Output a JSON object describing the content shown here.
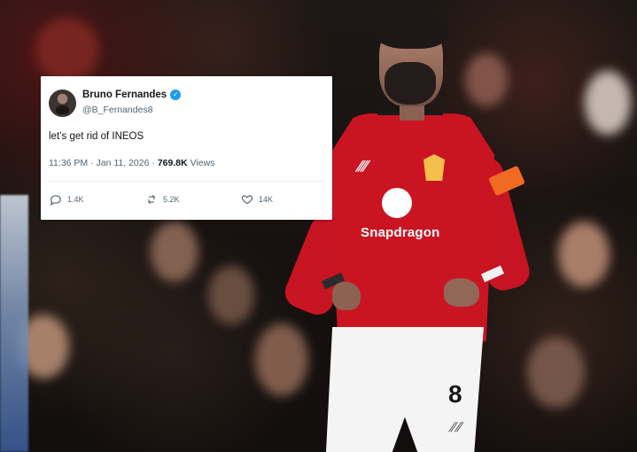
{
  "tweet": {
    "display_name": "Bruno Fernandes",
    "handle": "@B_Fernandes8",
    "text": "let’s get rid of INEOS",
    "time": "11:36 PM",
    "separator": "·",
    "date": "Jan 11, 2026",
    "views": "769.8K",
    "views_label": "Views",
    "replies": "1.4K",
    "reposts": "5.2K",
    "likes": "14K",
    "verified_icon": "verified-badge-icon",
    "reply_icon": "reply-icon",
    "repost_icon": "repost-icon",
    "like_icon": "like-icon",
    "accent": "#1d9bf0"
  },
  "photo": {
    "sponsor_text": "Snapdragon",
    "shirt_color": "#ca1422",
    "shorts_number": "8"
  }
}
